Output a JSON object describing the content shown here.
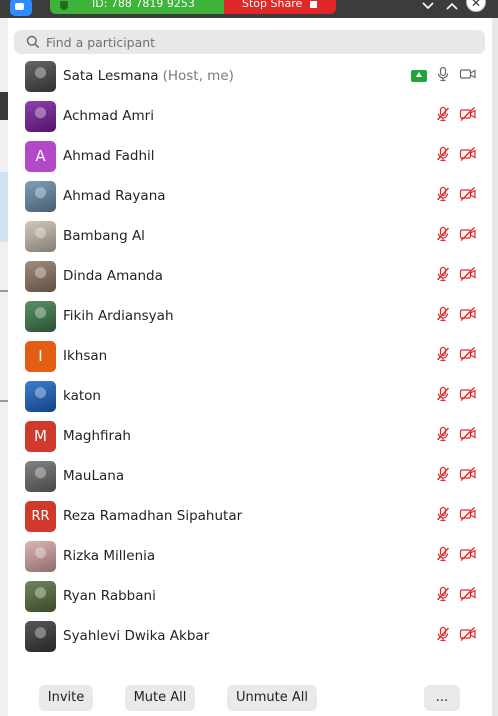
{
  "topbar": {
    "meeting_id": "ID: 788 7819 9253",
    "stop_share": "Stop Share"
  },
  "search": {
    "placeholder": "Find a participant"
  },
  "participants": [
    {
      "name": "Sata Lesmana",
      "tag": "(Host, me)",
      "avatar": "photo",
      "bg": "#4b4b4b",
      "host": true
    },
    {
      "name": "Achmad Amri",
      "avatar": "photo",
      "bg": "#7c1fa0"
    },
    {
      "name": "Ahmad Fadhil",
      "avatar": "A",
      "bg": "#b349c9"
    },
    {
      "name": "Ahmad Rayana",
      "avatar": "photo",
      "bg": "#6a8fb0"
    },
    {
      "name": "Bambang Al",
      "avatar": "photo",
      "bg": "#c9c0b0"
    },
    {
      "name": "Dinda Amanda",
      "avatar": "photo",
      "bg": "#8f7a66"
    },
    {
      "name": "Fikih Ardiansyah",
      "avatar": "photo",
      "bg": "#3f7d4d"
    },
    {
      "name": "Ikhsan",
      "avatar": "I",
      "bg": "#e35d13"
    },
    {
      "name": "katon",
      "avatar": "photo",
      "bg": "#1b67c9"
    },
    {
      "name": "Maghfirah",
      "avatar": "M",
      "bg": "#d03a2c"
    },
    {
      "name": "MauLana",
      "avatar": "photo",
      "bg": "#6d6d6d"
    },
    {
      "name": "Reza Ramadhan Sipahutar",
      "avatar": "RR",
      "bg": "#d03a2c"
    },
    {
      "name": "Rizka Millenia",
      "avatar": "photo",
      "bg": "#d9a7a7"
    },
    {
      "name": "Ryan Rabbani",
      "avatar": "photo",
      "bg": "#5a7040"
    },
    {
      "name": "Syahlevi Dwika Akbar",
      "avatar": "photo",
      "bg": "#3a3a3a"
    }
  ],
  "footer": {
    "invite": "Invite",
    "mute_all": "Mute All",
    "unmute_all": "Unmute All",
    "more": "..."
  },
  "colors": {
    "muted_red": "#e02828",
    "share_green": "#21a53b",
    "zoom_blue": "#2d8cff"
  }
}
